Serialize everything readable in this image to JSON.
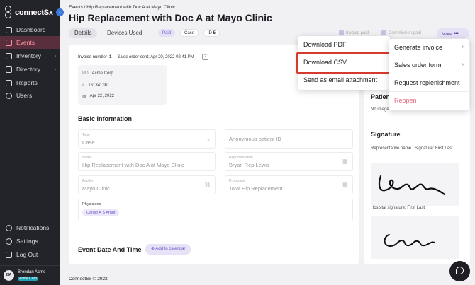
{
  "brand": {
    "name": "connectSx",
    "sub": "REE IT ALL"
  },
  "sidebar": {
    "items": [
      {
        "label": "Dashboard"
      },
      {
        "label": "Events"
      },
      {
        "label": "Inventory"
      },
      {
        "label": "Directory"
      },
      {
        "label": "Reports"
      },
      {
        "label": "Users"
      }
    ],
    "bottom_items": [
      {
        "label": "Notifications"
      },
      {
        "label": "Settings"
      },
      {
        "label": "Log Out"
      }
    ],
    "user": {
      "initials": "BA",
      "name": "Brendan Acme",
      "org": "Acme Corp"
    }
  },
  "header": {
    "breadcrumb": "Events / Hip Replacement with Doc A at Mayo Clinic",
    "title": "Hip Replacement with Doc A at Mayo Clinic",
    "tabs": [
      {
        "label": "Details"
      },
      {
        "label": "Devices Used"
      }
    ],
    "badges": {
      "paid": "Paid",
      "case": "Case",
      "id_label": "ID",
      "id_value": "5"
    },
    "checks": {
      "invoice_paid": "Invoice paid",
      "commission_paid": "Commission paid"
    },
    "more_label": "More"
  },
  "invoice": {
    "number_label": "Invoice number",
    "number": "1",
    "sent_label": "Sales order sent:",
    "sent_value": "Apr 20, 2022 02:41 PM",
    "po_label": "PO",
    "po_value": "Acme Corp",
    "hash_value": "161341361",
    "date_value": "Apr 22, 2022"
  },
  "basic": {
    "heading": "Basic Information",
    "type_label": "Type",
    "type_value": "Case",
    "anon_placeholder": "Anonymous patient ID",
    "name_label": "Name",
    "name_value": "Hip Replacement with Doc A at Mayo Clinic",
    "rep_label": "Representative",
    "rep_value": "Bryan Rep Lewis",
    "facility_label": "Facility",
    "facility_value": "Mayo Clinic",
    "procedure_label": "Procedure",
    "procedure_value": "Total Hip Replacement",
    "physicians_label": "Physicians",
    "physician_chip": "Carolo A S Arndt"
  },
  "event_date": {
    "heading": "Event Date And Time",
    "add_calendar": "Add to calendar"
  },
  "side": {
    "patient_heading": "Patien",
    "no_images": "No images",
    "signature_heading": "Signature",
    "rep_sig_label": "Representative name / Signature: First Last",
    "hosp_sig_label": "Hospital signature: First Last"
  },
  "menu_left": {
    "items": [
      "Download PDF",
      "Download CSV",
      "Send as email attachment"
    ]
  },
  "menu_right": {
    "items": [
      "Generate invoice",
      "Sales order form",
      "Request replenishment",
      "Reopen"
    ]
  },
  "footer": "ConnectSx © 2022",
  "colors": {
    "sidebar_bg": "#23232a",
    "active_bg": "#5a2f3d",
    "accent": "#6a58c8",
    "highlight": "#d63a2c"
  }
}
